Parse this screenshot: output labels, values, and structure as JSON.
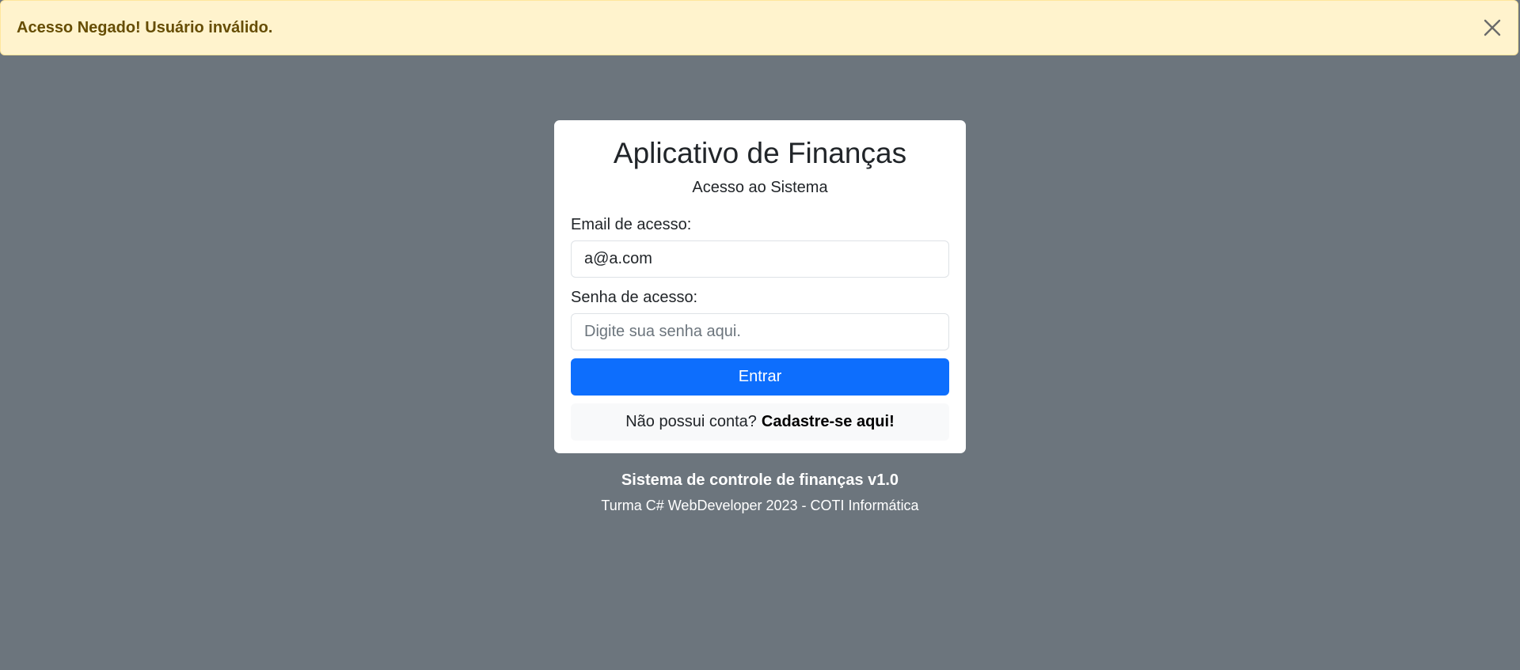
{
  "alert": {
    "message": "Acesso Negado! Usuário inválido.",
    "close_icon": "close-icon"
  },
  "card": {
    "title": "Aplicativo de Finanças",
    "subtitle": "Acesso ao Sistema",
    "email": {
      "label": "Email de acesso:",
      "value": "a@a.com"
    },
    "password": {
      "label": "Senha de acesso:",
      "placeholder": "Digite sua senha aqui."
    },
    "submit_label": "Entrar",
    "register": {
      "prompt": "Não possui conta?",
      "link": "Cadastre-se aqui!"
    }
  },
  "footer": {
    "title": "Sistema de controle de finanças v1.0",
    "subtitle": "Turma C# WebDeveloper 2023 - COTI Informática"
  },
  "colors": {
    "background": "#6c757d",
    "alert_bg": "#fff3cd",
    "alert_text": "#664d03",
    "primary": "#0d6efd"
  }
}
